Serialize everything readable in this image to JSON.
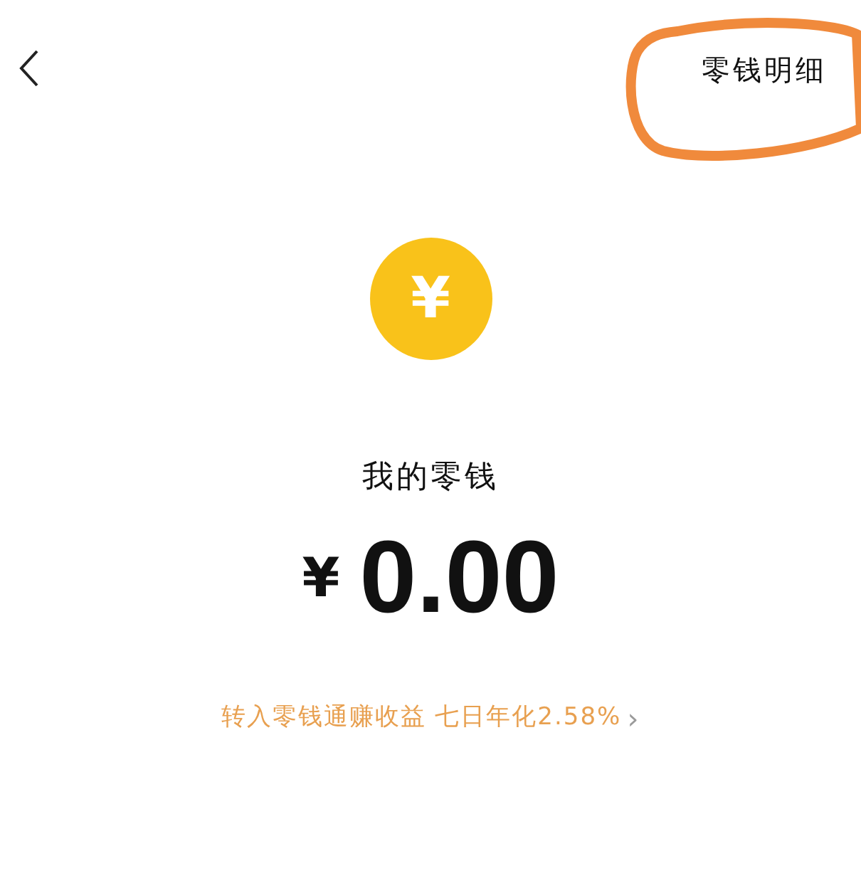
{
  "header": {
    "title": "零钱明细"
  },
  "coin": {
    "symbol": "¥"
  },
  "balance": {
    "label": "我的零钱",
    "currency": "¥",
    "amount": "0.00"
  },
  "promo": {
    "text": "转入零钱通赚收益 七日年化2.58%",
    "arrow": "›"
  }
}
